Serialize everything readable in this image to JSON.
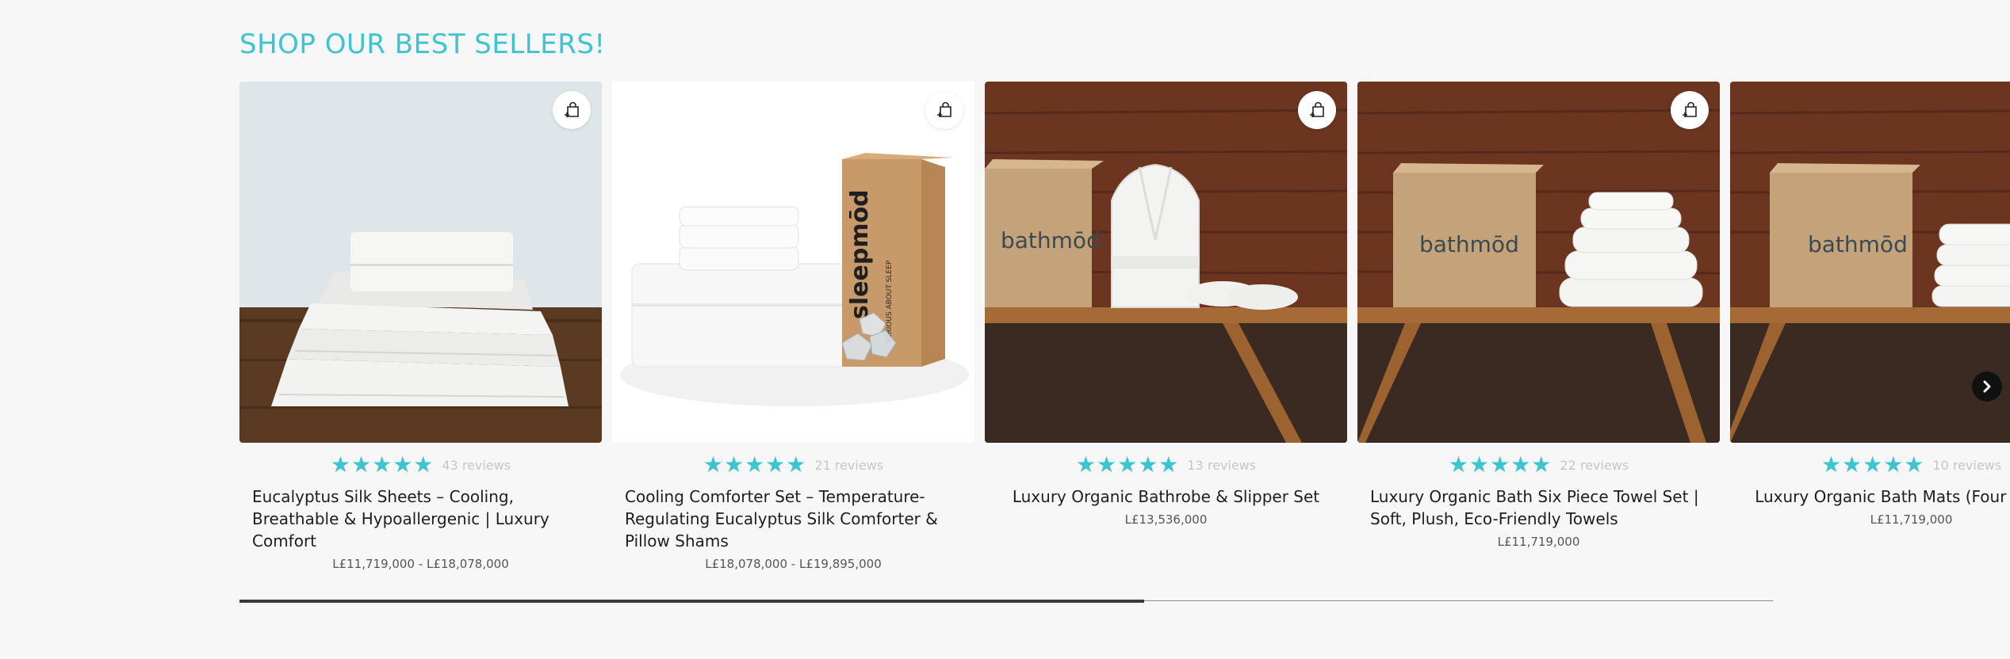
{
  "section": {
    "title": "SHOP OUR BEST SELLERS!"
  },
  "products": [
    {
      "stars": "★★★★★",
      "reviews": "43 reviews",
      "title": "Eucalyptus Silk Sheets – Cooling, Breathable & Hypoallergenic | Luxury Comfort",
      "price": "L£11,719,000 - L£18,078,000"
    },
    {
      "stars": "★★★★★",
      "reviews": "21 reviews",
      "title": "Cooling Comforter Set – Temperature-Regulating Eucalyptus Silk Comforter & Pillow Shams",
      "price": "L£18,078,000 - L£19,895,000",
      "box_brand": "sleepmōd",
      "box_tagline": "SERIOUS ABOUT SLEEP"
    },
    {
      "stars": "★★★★★",
      "reviews": "13 reviews",
      "title": "Luxury Organic Bathrobe & Slipper Set",
      "price": "L£13,536,000",
      "box_brand": "bathmōd"
    },
    {
      "stars": "★★★★★",
      "reviews": "22 reviews",
      "title": "Luxury Organic Bath Six Piece Towel Set | Soft, Plush, Eco-Friendly Towels",
      "price": "L£11,719,000",
      "box_brand": "bathmōd"
    },
    {
      "stars": "★★★★★",
      "reviews": "10 reviews",
      "title": "Luxury Organic Bath Mats (Four Pieces)",
      "price": "L£11,719,000",
      "box_brand": "bathmōd"
    }
  ],
  "carousel": {
    "progress_fraction": 0.59
  },
  "colors": {
    "accent": "#3ec4cf",
    "background": "#f7f7f7",
    "text": "#1e1e1e"
  },
  "icons": {
    "quick_add": "shopping-bag-plus-icon",
    "next": "chevron-right-icon"
  }
}
